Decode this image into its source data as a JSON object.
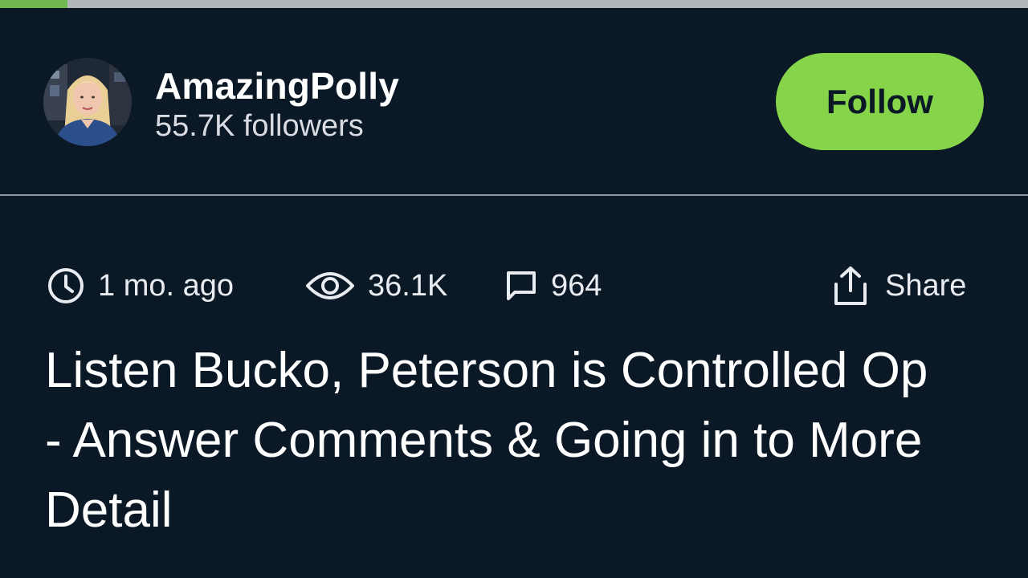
{
  "playback": {
    "progress_fraction": 0.066
  },
  "channel": {
    "name": "AmazingPolly",
    "followers": "55.7K followers",
    "follow_label": "Follow"
  },
  "meta": {
    "posted": "1 mo. ago",
    "views": "36.1K",
    "comments": "964",
    "share_label": "Share"
  },
  "video": {
    "title": "Listen Bucko, Peterson is Controlled Op - Answer Comments & Going in to More Detail"
  },
  "icons": {
    "clock": "clock-icon",
    "eye": "eye-icon",
    "comment": "comment-icon",
    "share": "share-icon"
  },
  "colors": {
    "background": "#0b1826",
    "follow_accent": "#85d44a",
    "progress_fill": "#6fb94f",
    "progress_track": "#b3b6ba"
  }
}
